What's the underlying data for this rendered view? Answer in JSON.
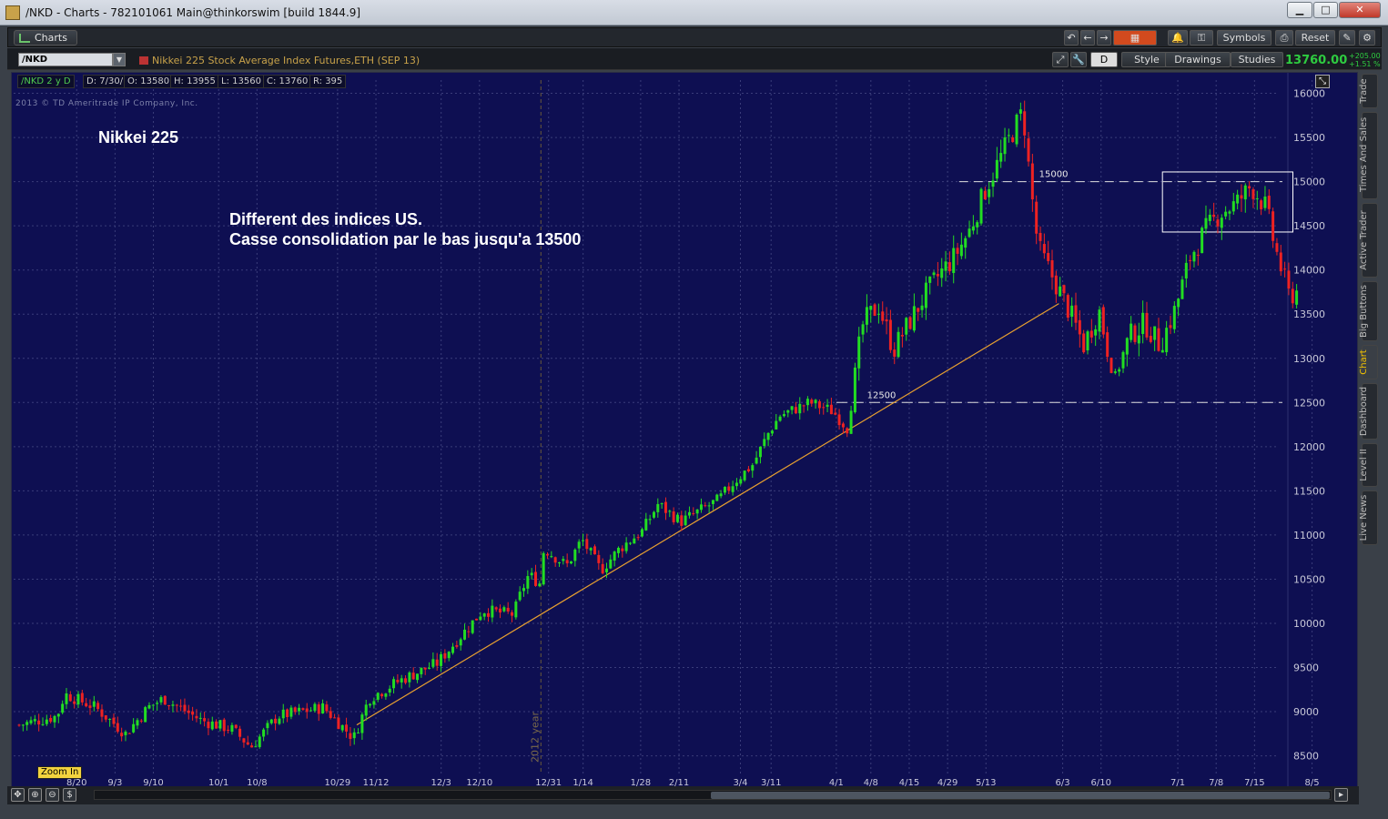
{
  "window": {
    "title": "/NKD - Charts - 782101061 Main@thinkorswim [build 1844.9]",
    "min_label": "▁",
    "max_label": "□",
    "close_label": "✕"
  },
  "toolbar": {
    "charts_tab": "Charts",
    "symbols": "Symbols",
    "reset": "Reset"
  },
  "symbol_bar": {
    "symbol": "/NKD",
    "description": "Nikkei 225 Stock Average Index Futures,ETH (SEP 13)",
    "period_button": "D",
    "style": "Style",
    "drawings": "Drawings",
    "studies": "Studies",
    "last_price": "13760.00",
    "change_abs": "+205.00",
    "change_pct": "+1.51 %"
  },
  "info_bar": {
    "period": "/NKD 2 y D",
    "date": "D: 7/30/13",
    "open": "O: 13580",
    "high": "H: 13955",
    "low": "L: 13560",
    "close": "C: 13760",
    "range": "R: 395"
  },
  "annotations": {
    "copyright": "2013 © TD Ameritrade IP Company, Inc.",
    "title": "Nikkei 225",
    "line1": "Different des indices US.",
    "line2": "Casse consolidation par le bas jusqu'a 13500",
    "level_high": "15000",
    "level_low": "12500",
    "year_marker": "2012 year",
    "zoom_in": "Zoom In"
  },
  "side_tabs": [
    "Trade",
    "Times And Sales",
    "Active Trader",
    "Big Buttons",
    "Chart",
    "Dashboard",
    "Level II",
    "Live News"
  ],
  "colors": {
    "background": "#0e0f52",
    "up": "#22dd22",
    "down": "#ee2222",
    "trendline": "#e8a030",
    "grid": "#3a3d7a"
  },
  "chart_data": {
    "type": "candlestick",
    "title": "Nikkei 225",
    "ylim": [
      8300,
      16150
    ],
    "y_ticks": [
      8500,
      9000,
      9500,
      10000,
      10500,
      11000,
      11500,
      12000,
      12500,
      13000,
      13500,
      14000,
      14500,
      15000,
      15500,
      16000
    ],
    "x_ticks": [
      "8/20",
      "9/3",
      "9/10",
      "10/1",
      "10/8",
      "10/29",
      "11/12",
      "12/3",
      "12/10",
      "12/31",
      "1/14",
      "1/28",
      "2/11",
      "3/4",
      "3/11",
      "4/1",
      "4/8",
      "4/15",
      "4/29",
      "5/13",
      "6/3",
      "6/10",
      "7/1",
      "7/8",
      "7/15",
      "8/5"
    ],
    "x_tick_index": [
      15,
      25,
      35,
      52,
      62,
      83,
      93,
      110,
      120,
      138,
      147,
      162,
      172,
      188,
      196,
      213,
      222,
      232,
      242,
      252,
      272,
      282,
      302,
      312,
      322,
      337
    ],
    "levels": [
      15000,
      12500
    ],
    "box": {
      "from_index": 298,
      "to_index": 332,
      "low": 14430,
      "high": 15110
    },
    "trendline": {
      "from": [
        88,
        8850
      ],
      "to": [
        271,
        13620
      ]
    },
    "year_marker_index": 136,
    "candles_count": 325,
    "close_path": [
      [
        0,
        8850
      ],
      [
        10,
        8950
      ],
      [
        12,
        9200
      ],
      [
        20,
        9050
      ],
      [
        28,
        8750
      ],
      [
        34,
        9050
      ],
      [
        38,
        9150
      ],
      [
        48,
        8900
      ],
      [
        56,
        8800
      ],
      [
        61,
        8600
      ],
      [
        68,
        8950
      ],
      [
        74,
        9000
      ],
      [
        80,
        9050
      ],
      [
        88,
        8700
      ],
      [
        92,
        9150
      ],
      [
        100,
        9350
      ],
      [
        110,
        9550
      ],
      [
        122,
        10150
      ],
      [
        130,
        10100
      ],
      [
        132,
        10350
      ],
      [
        134,
        10550
      ],
      [
        137,
        10450
      ],
      [
        138,
        10850
      ],
      [
        144,
        10650
      ],
      [
        148,
        10950
      ],
      [
        153,
        10600
      ],
      [
        158,
        10850
      ],
      [
        164,
        11050
      ],
      [
        168,
        11350
      ],
      [
        174,
        11150
      ],
      [
        180,
        11300
      ],
      [
        184,
        11400
      ],
      [
        188,
        11600
      ],
      [
        193,
        11800
      ],
      [
        197,
        12150
      ],
      [
        200,
        12350
      ],
      [
        208,
        12500
      ],
      [
        214,
        12400
      ],
      [
        218,
        12200
      ],
      [
        220,
        12900
      ],
      [
        222,
        13400
      ],
      [
        226,
        13600
      ],
      [
        230,
        13100
      ],
      [
        234,
        13400
      ],
      [
        238,
        13700
      ],
      [
        242,
        13950
      ],
      [
        246,
        14150
      ],
      [
        250,
        14450
      ],
      [
        254,
        14900
      ],
      [
        260,
        15450
      ],
      [
        264,
        15800
      ],
      [
        266,
        14950
      ],
      [
        268,
        14250
      ],
      [
        272,
        13900
      ],
      [
        276,
        13550
      ],
      [
        280,
        13150
      ],
      [
        284,
        13550
      ],
      [
        288,
        12750
      ],
      [
        292,
        13250
      ],
      [
        296,
        13400
      ],
      [
        300,
        13150
      ],
      [
        304,
        13550
      ],
      [
        308,
        14150
      ],
      [
        312,
        14450
      ],
      [
        316,
        14650
      ],
      [
        320,
        14750
      ],
      [
        324,
        14950
      ],
      [
        328,
        14700
      ],
      [
        330,
        14300
      ],
      [
        334,
        13700
      ],
      [
        336,
        13760
      ]
    ]
  }
}
